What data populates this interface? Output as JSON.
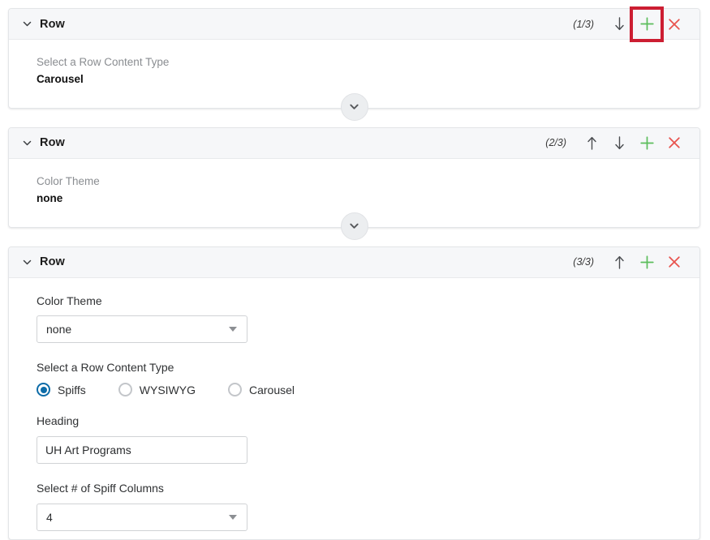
{
  "rows": [
    {
      "chevron_icon": "chevron-down-icon",
      "title": "Row",
      "counter": "(1/3)",
      "actions": [
        {
          "icon": "arrow-down-icon",
          "name": "move-row-down-button",
          "highlighted": false
        },
        {
          "icon": "plus-icon",
          "name": "add-row-button",
          "highlighted": true
        },
        {
          "icon": "close-x-icon",
          "name": "delete-row-button",
          "highlighted": false
        }
      ],
      "summary": {
        "label": "Select a Row Content Type",
        "value": "Carousel"
      },
      "expand_chevron_icon": "chevron-down-icon"
    },
    {
      "chevron_icon": "chevron-down-icon",
      "title": "Row",
      "counter": "(2/3)",
      "actions": [
        {
          "icon": "arrow-up-icon",
          "name": "move-row-up-button",
          "highlighted": false
        },
        {
          "icon": "arrow-down-icon",
          "name": "move-row-down-button",
          "highlighted": false
        },
        {
          "icon": "plus-icon",
          "name": "add-row-button",
          "highlighted": false
        },
        {
          "icon": "close-x-icon",
          "name": "delete-row-button",
          "highlighted": false
        }
      ],
      "summary": {
        "label": "Color Theme",
        "value": "none"
      },
      "expand_chevron_icon": "chevron-down-icon"
    },
    {
      "chevron_icon": "chevron-down-icon",
      "title": "Row",
      "counter": "(3/3)",
      "actions": [
        {
          "icon": "arrow-up-icon",
          "name": "move-row-up-button",
          "highlighted": false
        },
        {
          "icon": "plus-icon",
          "name": "add-row-button",
          "highlighted": false
        },
        {
          "icon": "close-x-icon",
          "name": "delete-row-button",
          "highlighted": false
        }
      ],
      "form": {
        "color_theme": {
          "label": "Color Theme",
          "value": "none"
        },
        "content_type": {
          "label": "Select a Row Content Type",
          "options": [
            {
              "label": "Spiffs",
              "selected": true
            },
            {
              "label": "WYSIWYG",
              "selected": false
            },
            {
              "label": "Carousel",
              "selected": false
            }
          ]
        },
        "heading": {
          "label": "Heading",
          "value": "UH Art Programs",
          "placeholder": ""
        },
        "spiff_columns": {
          "label": "Select # of Spiff Columns",
          "value": "4"
        }
      }
    }
  ],
  "colors": {
    "accent_green": "#5bbd5b",
    "accent_red": "#e8544f",
    "highlight_red": "#cc1e32",
    "radio_blue": "#0d6ca8",
    "arrow_gray": "#4a4d50"
  }
}
